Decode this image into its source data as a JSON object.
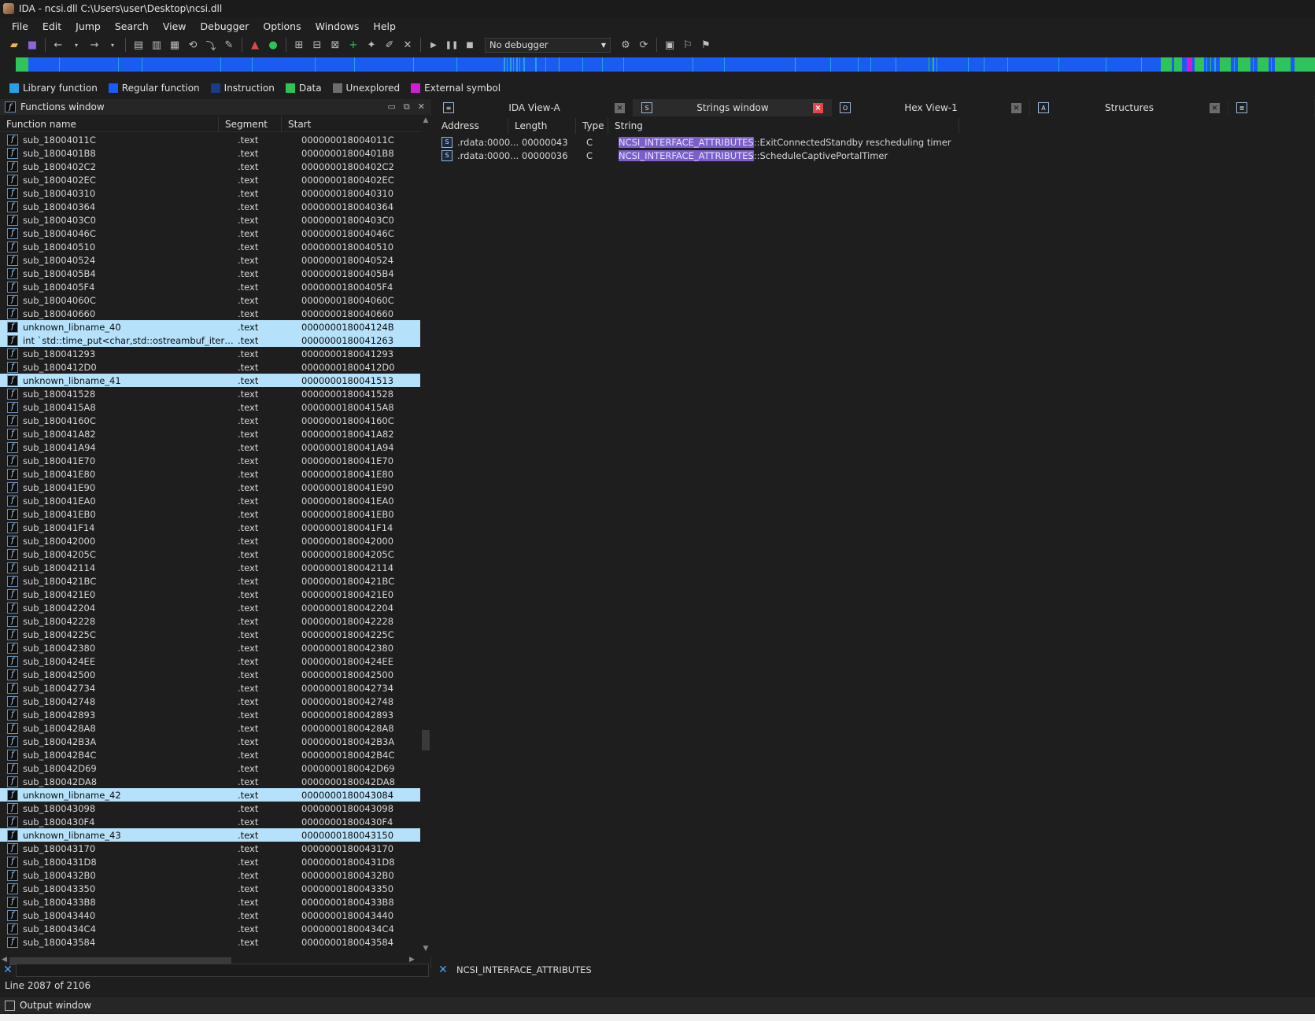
{
  "window": {
    "title": "IDA - ncsi.dll C:\\Users\\user\\Desktop\\ncsi.dll"
  },
  "menu": [
    "File",
    "Edit",
    "Jump",
    "Search",
    "View",
    "Debugger",
    "Options",
    "Windows",
    "Help"
  ],
  "toolbar": {
    "debugger_select": "No debugger"
  },
  "legend": [
    {
      "label": "Library function",
      "color": "#28a0e6"
    },
    {
      "label": "Regular function",
      "color": "#1a5cf2"
    },
    {
      "label": "Instruction",
      "color": "#1a3a8a"
    },
    {
      "label": "Data",
      "color": "#2ec45a"
    },
    {
      "label": "Unexplored",
      "color": "#6e6e6e"
    },
    {
      "label": "External symbol",
      "color": "#d21ed2"
    }
  ],
  "functions_window": {
    "title": "Functions window",
    "columns": [
      "Function name",
      "Segment",
      "Start"
    ],
    "rows": [
      {
        "name": "sub_18004011C",
        "segment": ".text",
        "start": "000000018004011C",
        "library": false
      },
      {
        "name": "sub_1800401B8",
        "segment": ".text",
        "start": "00000001800401B8",
        "library": false
      },
      {
        "name": "sub_1800402C2",
        "segment": ".text",
        "start": "00000001800402C2",
        "library": false
      },
      {
        "name": "sub_1800402EC",
        "segment": ".text",
        "start": "00000001800402EC",
        "library": false
      },
      {
        "name": "sub_180040310",
        "segment": ".text",
        "start": "0000000180040310",
        "library": false
      },
      {
        "name": "sub_180040364",
        "segment": ".text",
        "start": "0000000180040364",
        "library": false
      },
      {
        "name": "sub_1800403C0",
        "segment": ".text",
        "start": "00000001800403C0",
        "library": false
      },
      {
        "name": "sub_18004046C",
        "segment": ".text",
        "start": "000000018004046C",
        "library": false
      },
      {
        "name": "sub_180040510",
        "segment": ".text",
        "start": "0000000180040510",
        "library": false
      },
      {
        "name": "sub_180040524",
        "segment": ".text",
        "start": "0000000180040524",
        "library": false
      },
      {
        "name": "sub_1800405B4",
        "segment": ".text",
        "start": "00000001800405B4",
        "library": false
      },
      {
        "name": "sub_1800405F4",
        "segment": ".text",
        "start": "00000001800405F4",
        "library": false
      },
      {
        "name": "sub_18004060C",
        "segment": ".text",
        "start": "000000018004060C",
        "library": false
      },
      {
        "name": "sub_180040660",
        "segment": ".text",
        "start": "0000000180040660",
        "library": false
      },
      {
        "name": "unknown_libname_40",
        "segment": ".text",
        "start": "000000018004124B",
        "library": true
      },
      {
        "name": "int `std::time_put<char,std::ostreambuf_iterator<c...",
        "segment": ".text",
        "start": "0000000180041263",
        "library": true
      },
      {
        "name": "sub_180041293",
        "segment": ".text",
        "start": "0000000180041293",
        "library": false
      },
      {
        "name": "sub_1800412D0",
        "segment": ".text",
        "start": "00000001800412D0",
        "library": false
      },
      {
        "name": "unknown_libname_41",
        "segment": ".text",
        "start": "0000000180041513",
        "library": true
      },
      {
        "name": "sub_180041528",
        "segment": ".text",
        "start": "0000000180041528",
        "library": false
      },
      {
        "name": "sub_1800415A8",
        "segment": ".text",
        "start": "00000001800415A8",
        "library": false
      },
      {
        "name": "sub_18004160C",
        "segment": ".text",
        "start": "000000018004160C",
        "library": false
      },
      {
        "name": "sub_180041A82",
        "segment": ".text",
        "start": "0000000180041A82",
        "library": false
      },
      {
        "name": "sub_180041A94",
        "segment": ".text",
        "start": "0000000180041A94",
        "library": false
      },
      {
        "name": "sub_180041E70",
        "segment": ".text",
        "start": "0000000180041E70",
        "library": false
      },
      {
        "name": "sub_180041E80",
        "segment": ".text",
        "start": "0000000180041E80",
        "library": false
      },
      {
        "name": "sub_180041E90",
        "segment": ".text",
        "start": "0000000180041E90",
        "library": false
      },
      {
        "name": "sub_180041EA0",
        "segment": ".text",
        "start": "0000000180041EA0",
        "library": false
      },
      {
        "name": "sub_180041EB0",
        "segment": ".text",
        "start": "0000000180041EB0",
        "library": false
      },
      {
        "name": "sub_180041F14",
        "segment": ".text",
        "start": "0000000180041F14",
        "library": false
      },
      {
        "name": "sub_180042000",
        "segment": ".text",
        "start": "0000000180042000",
        "library": false
      },
      {
        "name": "sub_18004205C",
        "segment": ".text",
        "start": "000000018004205C",
        "library": false
      },
      {
        "name": "sub_180042114",
        "segment": ".text",
        "start": "0000000180042114",
        "library": false
      },
      {
        "name": "sub_1800421BC",
        "segment": ".text",
        "start": "00000001800421BC",
        "library": false
      },
      {
        "name": "sub_1800421E0",
        "segment": ".text",
        "start": "00000001800421E0",
        "library": false
      },
      {
        "name": "sub_180042204",
        "segment": ".text",
        "start": "0000000180042204",
        "library": false
      },
      {
        "name": "sub_180042228",
        "segment": ".text",
        "start": "0000000180042228",
        "library": false
      },
      {
        "name": "sub_18004225C",
        "segment": ".text",
        "start": "000000018004225C",
        "library": false
      },
      {
        "name": "sub_180042380",
        "segment": ".text",
        "start": "0000000180042380",
        "library": false
      },
      {
        "name": "sub_1800424EE",
        "segment": ".text",
        "start": "00000001800424EE",
        "library": false
      },
      {
        "name": "sub_180042500",
        "segment": ".text",
        "start": "0000000180042500",
        "library": false
      },
      {
        "name": "sub_180042734",
        "segment": ".text",
        "start": "0000000180042734",
        "library": false
      },
      {
        "name": "sub_180042748",
        "segment": ".text",
        "start": "0000000180042748",
        "library": false
      },
      {
        "name": "sub_180042893",
        "segment": ".text",
        "start": "0000000180042893",
        "library": false
      },
      {
        "name": "sub_1800428A8",
        "segment": ".text",
        "start": "00000001800428A8",
        "library": false
      },
      {
        "name": "sub_180042B3A",
        "segment": ".text",
        "start": "0000000180042B3A",
        "library": false
      },
      {
        "name": "sub_180042B4C",
        "segment": ".text",
        "start": "0000000180042B4C",
        "library": false
      },
      {
        "name": "sub_180042D69",
        "segment": ".text",
        "start": "0000000180042D69",
        "library": false
      },
      {
        "name": "sub_180042DA8",
        "segment": ".text",
        "start": "0000000180042DA8",
        "library": false
      },
      {
        "name": "unknown_libname_42",
        "segment": ".text",
        "start": "0000000180043084",
        "library": true
      },
      {
        "name": "sub_180043098",
        "segment": ".text",
        "start": "0000000180043098",
        "library": false
      },
      {
        "name": "sub_1800430F4",
        "segment": ".text",
        "start": "00000001800430F4",
        "library": false
      },
      {
        "name": "unknown_libname_43",
        "segment": ".text",
        "start": "0000000180043150",
        "library": true
      },
      {
        "name": "sub_180043170",
        "segment": ".text",
        "start": "0000000180043170",
        "library": false
      },
      {
        "name": "sub_1800431D8",
        "segment": ".text",
        "start": "00000001800431D8",
        "library": false
      },
      {
        "name": "sub_1800432B0",
        "segment": ".text",
        "start": "00000001800432B0",
        "library": false
      },
      {
        "name": "sub_180043350",
        "segment": ".text",
        "start": "0000000180043350",
        "library": false
      },
      {
        "name": "sub_1800433B8",
        "segment": ".text",
        "start": "00000001800433B8",
        "library": false
      },
      {
        "name": "sub_180043440",
        "segment": ".text",
        "start": "0000000180043440",
        "library": false
      },
      {
        "name": "sub_1800434C4",
        "segment": ".text",
        "start": "00000001800434C4",
        "library": false
      },
      {
        "name": "sub_180043584",
        "segment": ".text",
        "start": "0000000180043584",
        "library": false
      }
    ]
  },
  "tabs": [
    {
      "label": "IDA View-A",
      "active": false
    },
    {
      "label": "Strings window",
      "active": true
    },
    {
      "label": "Hex View-1",
      "active": false
    },
    {
      "label": "Structures",
      "active": false
    }
  ],
  "strings_window": {
    "columns": [
      "Address",
      "Length",
      "Type",
      "String"
    ],
    "rows": [
      {
        "address": ".rdata:0000...",
        "length": "00000043",
        "type": "C",
        "match": "NCSI_INTERFACE_ATTRIBUTES",
        "rest": "::ExitConnectedStandby rescheduling timer"
      },
      {
        "address": ".rdata:0000...",
        "length": "00000036",
        "type": "C",
        "match": "NCSI_INTERFACE_ATTRIBUTES",
        "rest": "::ScheduleCaptivePortalTimer"
      }
    ]
  },
  "filters": {
    "functions_filter": "",
    "strings_filter": "NCSI_INTERFACE_ATTRIBUTES"
  },
  "status": {
    "line": "Line 2087 of 2106"
  },
  "output_window": {
    "title": "Output window"
  }
}
